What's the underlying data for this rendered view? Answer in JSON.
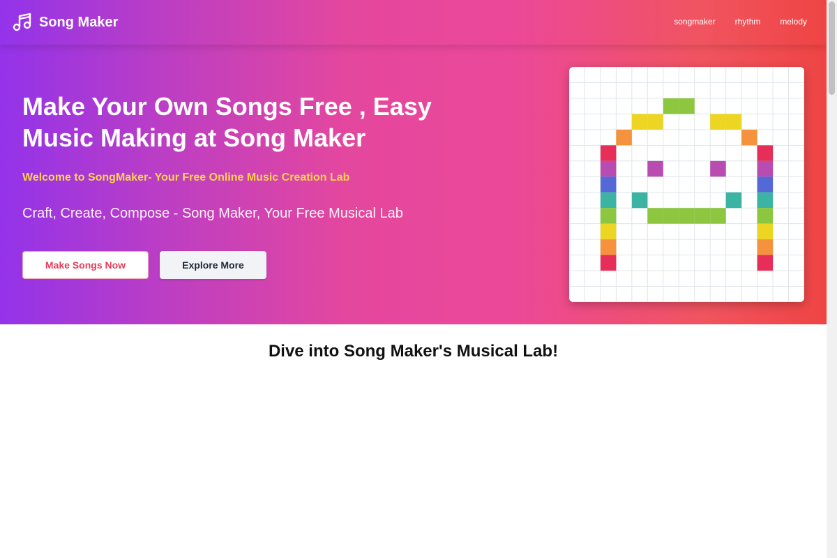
{
  "header": {
    "brand_name": "Song Maker",
    "brand_icon": "music-note-icon",
    "nav": [
      {
        "label": "songmaker"
      },
      {
        "label": "rhythm"
      },
      {
        "label": "melody"
      }
    ]
  },
  "hero": {
    "title": "Make Your Own Songs Free , Easy Music Making at Song Maker",
    "subtitle": "Welcome to SongMaker- Your Free Online Music Creation Lab",
    "tagline": "Craft, Create, Compose - Song Maker, Your Free Musical Lab",
    "primary_button": "Make Songs Now",
    "secondary_button": "Explore More"
  },
  "note_grid": {
    "columns": 15,
    "rows": 15,
    "cells": [
      {
        "col": 6,
        "row": 2,
        "color": "#8dc63f"
      },
      {
        "col": 7,
        "row": 2,
        "color": "#8dc63f"
      },
      {
        "col": 4,
        "row": 3,
        "color": "#edd523"
      },
      {
        "col": 5,
        "row": 3,
        "color": "#edd523"
      },
      {
        "col": 9,
        "row": 3,
        "color": "#edd523"
      },
      {
        "col": 10,
        "row": 3,
        "color": "#edd523"
      },
      {
        "col": 3,
        "row": 4,
        "color": "#f5923e"
      },
      {
        "col": 11,
        "row": 4,
        "color": "#f5923e"
      },
      {
        "col": 2,
        "row": 5,
        "color": "#e62e58"
      },
      {
        "col": 12,
        "row": 5,
        "color": "#e62e58"
      },
      {
        "col": 2,
        "row": 6,
        "color": "#b84cb0"
      },
      {
        "col": 5,
        "row": 6,
        "color": "#b84cb0"
      },
      {
        "col": 9,
        "row": 6,
        "color": "#b84cb0"
      },
      {
        "col": 12,
        "row": 6,
        "color": "#b84cb0"
      },
      {
        "col": 2,
        "row": 7,
        "color": "#5568d8"
      },
      {
        "col": 12,
        "row": 7,
        "color": "#5568d8"
      },
      {
        "col": 2,
        "row": 8,
        "color": "#3cb4a4"
      },
      {
        "col": 4,
        "row": 8,
        "color": "#3cb4a4"
      },
      {
        "col": 10,
        "row": 8,
        "color": "#3cb4a4"
      },
      {
        "col": 12,
        "row": 8,
        "color": "#3cb4a4"
      },
      {
        "col": 2,
        "row": 9,
        "color": "#8dc63f"
      },
      {
        "col": 5,
        "row": 9,
        "color": "#8dc63f"
      },
      {
        "col": 6,
        "row": 9,
        "color": "#8dc63f"
      },
      {
        "col": 7,
        "row": 9,
        "color": "#8dc63f"
      },
      {
        "col": 8,
        "row": 9,
        "color": "#8dc63f"
      },
      {
        "col": 9,
        "row": 9,
        "color": "#8dc63f"
      },
      {
        "col": 12,
        "row": 9,
        "color": "#8dc63f"
      },
      {
        "col": 2,
        "row": 10,
        "color": "#edd523"
      },
      {
        "col": 12,
        "row": 10,
        "color": "#edd523"
      },
      {
        "col": 2,
        "row": 11,
        "color": "#f5923e"
      },
      {
        "col": 12,
        "row": 11,
        "color": "#f5923e"
      },
      {
        "col": 2,
        "row": 12,
        "color": "#e62e58"
      },
      {
        "col": 12,
        "row": 12,
        "color": "#e62e58"
      }
    ]
  },
  "section": {
    "heading": "Dive into Song Maker's Musical Lab!"
  },
  "colors": {
    "gradient_start": "#9333ea",
    "gradient_end": "#ef4444",
    "subtitle_accent": "#fcd34d",
    "primary_button_text": "#e53e5a"
  }
}
